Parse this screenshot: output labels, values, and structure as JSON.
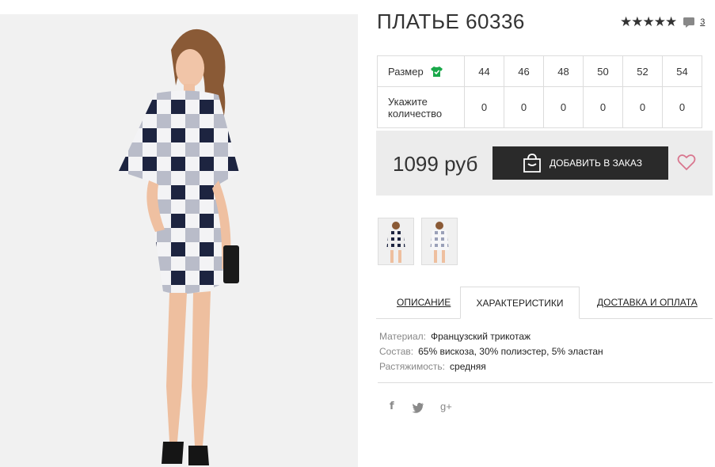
{
  "product": {
    "title": "ПЛАТЬЕ 60336",
    "stars": "★★★★★",
    "comments_count": "3"
  },
  "sizes_table": {
    "size_label": "Размер",
    "qty_label_line1": "Укажите",
    "qty_label_line2": "количество",
    "sizes": [
      "44",
      "46",
      "48",
      "50",
      "52",
      "54"
    ],
    "quantities": [
      "0",
      "0",
      "0",
      "0",
      "0",
      "0"
    ]
  },
  "purchase": {
    "price": "1099 руб",
    "add_button": "ДОБАВИТЬ В ЗАКАЗ"
  },
  "tabs": {
    "description": "ОПИСАНИЕ",
    "characteristics": "ХАРАКТЕРИСТИКИ",
    "delivery": "ДОСТАВКА И ОПЛАТА"
  },
  "specs": [
    {
      "key": "Материал:",
      "value": "Французский трикотаж"
    },
    {
      "key": "Состав:",
      "value": "65% вискоза, 30% полиэстер, 5% эластан"
    },
    {
      "key": "Растяжимость:",
      "value": "средняя"
    }
  ],
  "social": {
    "facebook": "f",
    "twitter": "twitter-icon",
    "googleplus": "g+"
  },
  "colors": {
    "dark": "#2a2a2a",
    "accent_green": "#19a84a",
    "heart": "#d9778f",
    "panel": "#ececec"
  }
}
